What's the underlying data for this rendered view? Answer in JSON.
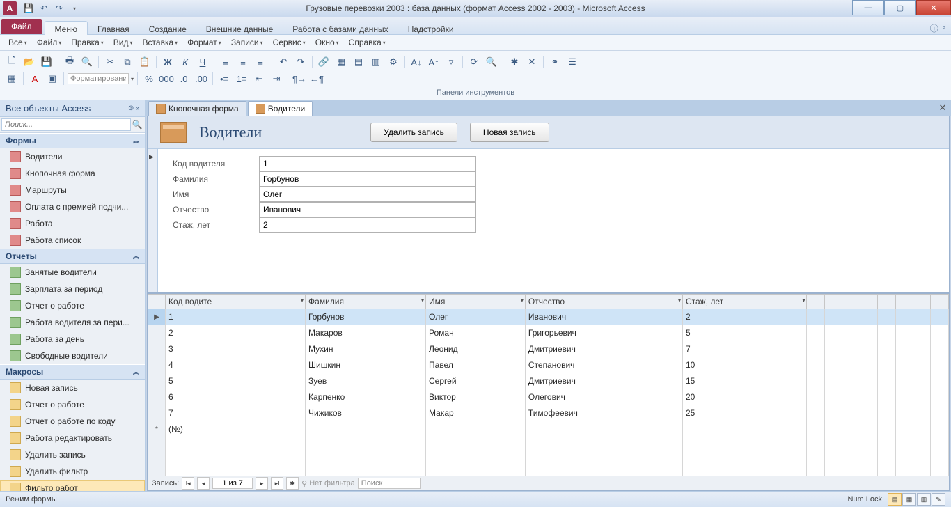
{
  "titlebar": {
    "title": "Грузовые перевозки 2003 : база данных (формат Access 2002 - 2003)  -  Microsoft Access"
  },
  "ribbon": {
    "file": "Файл",
    "tabs": [
      "Меню",
      "Главная",
      "Создание",
      "Внешние данные",
      "Работа с базами данных",
      "Надстройки"
    ],
    "active_tab": 0
  },
  "menubar": [
    "Все",
    "Файл",
    "Правка",
    "Вид",
    "Вставка",
    "Формат",
    "Записи",
    "Сервис",
    "Окно",
    "Справка"
  ],
  "toolbar_group_label": "Панели инструментов",
  "format_dropdown": "Форматирование",
  "navpane": {
    "header": "Все объекты Access",
    "search_placeholder": "Поиск...",
    "groups": [
      {
        "title": "Формы",
        "type": "form",
        "items": [
          "Водители",
          "Кнопочная форма",
          "Маршруты",
          "Оплата с премией подчи...",
          "Работа",
          "Работа список"
        ]
      },
      {
        "title": "Отчеты",
        "type": "report",
        "items": [
          "Занятые водители",
          "Зарплата за период",
          "Отчет о работе",
          "Работа водителя за пери...",
          "Работа за день",
          "Свободные водители"
        ]
      },
      {
        "title": "Макросы",
        "type": "macro",
        "items": [
          "Новая запись",
          "Отчет о работе",
          "Отчет о работе по коду",
          "Работа редактировать",
          "Удалить запись",
          "Удалить фильтр",
          "Фильтр работ"
        ]
      }
    ],
    "selected": "Фильтр работ"
  },
  "doc_tabs": {
    "tabs": [
      {
        "label": "Кнопочная форма"
      },
      {
        "label": "Водители"
      }
    ],
    "active": 1
  },
  "form": {
    "title": "Водители",
    "btn_delete": "Удалить запись",
    "btn_new": "Новая запись",
    "fields": [
      {
        "label": "Код водителя",
        "value": "1"
      },
      {
        "label": "Фамилия",
        "value": "Горбунов"
      },
      {
        "label": "Имя",
        "value": "Олег"
      },
      {
        "label": "Отчество",
        "value": "Иванович"
      },
      {
        "label": "Стаж, лет",
        "value": "2"
      }
    ]
  },
  "datasheet": {
    "columns": [
      "Код водите",
      "Фамилия",
      "Имя",
      "Отчество",
      "Стаж, лет"
    ],
    "rows": [
      [
        "1",
        "Горбунов",
        "Олег",
        "Иванович",
        "2"
      ],
      [
        "2",
        "Макаров",
        "Роман",
        "Григорьевич",
        "5"
      ],
      [
        "3",
        "Мухин",
        "Леонид",
        "Дмитриевич",
        "7"
      ],
      [
        "4",
        "Шишкин",
        "Павел",
        "Степанович",
        "10"
      ],
      [
        "5",
        "Зуев",
        "Сергей",
        "Дмитриевич",
        "15"
      ],
      [
        "6",
        "Карпенко",
        "Виктор",
        "Олегович",
        "20"
      ],
      [
        "7",
        "Чижиков",
        "Макар",
        "Тимофеевич",
        "25"
      ]
    ],
    "new_row_label": "(№)",
    "selected_row": 0
  },
  "recnav": {
    "label": "Запись:",
    "pos": "1 из 7",
    "no_filter": "Нет фильтра",
    "search": "Поиск"
  },
  "statusbar": {
    "mode": "Режим формы",
    "numlock": "Num Lock"
  }
}
